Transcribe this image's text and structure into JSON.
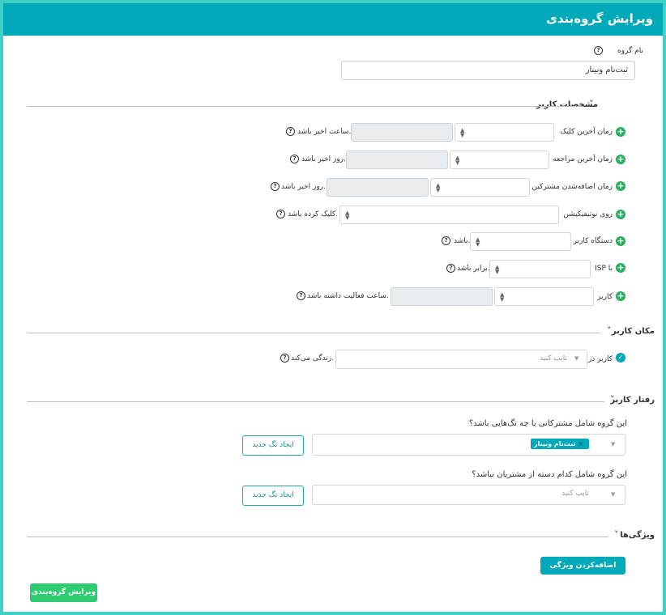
{
  "header": {
    "title": "ویرایش گروه‌بندی"
  },
  "group_name": {
    "label": "نام گروه",
    "value": "ثبت‌نام وبینار"
  },
  "user_specs": {
    "title": "مشخصات کاربر",
    "rows": [
      {
        "label": "زمان آخرین کلیک",
        "suffix": "ساعت اخیر باشد."
      },
      {
        "label": "زمان آخرین مراجعه",
        "suffix": "روز اخیر باشد."
      },
      {
        "label": "زمان اضافه‌شدن مشترکین",
        "suffix": "روز اخیر باشد."
      },
      {
        "label": "روی نوتیفیکیشن",
        "suffix": "کلیک کرده باشد."
      },
      {
        "label": "دستگاه کاربر",
        "suffix": "باشد."
      },
      {
        "label": "ISP با",
        "suffix": "برابر باشد."
      },
      {
        "label": "کاربر",
        "suffix": "ساعت فعالیت داشته باشد."
      }
    ]
  },
  "location": {
    "title": "مکان کاربر",
    "label": "کاربر در",
    "placeholder": "تایپ کنید",
    "suffix": "زندگی می‌کند."
  },
  "behavior": {
    "title": "رفتار کاربر",
    "include_question": "این گروه شامل مشترکانی با چه تگ‌هایی باشد؟",
    "include_tag": "ثبت‌نام وبینار",
    "include_tag_remove": "×",
    "exclude_question": "این گروه شامل کدام دسته از مشتریان نباشد؟",
    "exclude_placeholder": "تایپ کنید",
    "new_tag_button": "ایجاد تگ جدید"
  },
  "features": {
    "title": "ویژگی‌ها",
    "add_button": "اضافه‌کردن ویژگی جدید"
  },
  "footer": {
    "submit_button": "ویرایش گروه‌بندی"
  },
  "icons": {
    "help": "?",
    "plus": "+",
    "check": "✓",
    "chevron_down": "˅",
    "select_arrows": "▲▼"
  },
  "colors": {
    "header": "#00a9b9",
    "frame": "#3fd0c8",
    "plus": "#27ae60",
    "submit": "#2ecc71"
  }
}
